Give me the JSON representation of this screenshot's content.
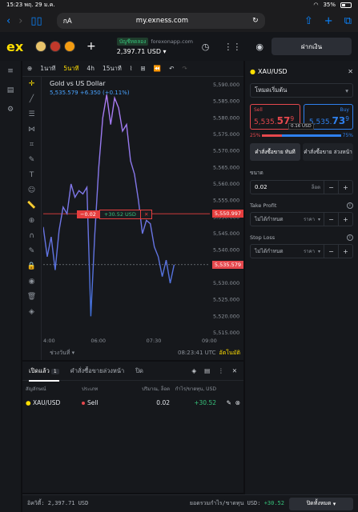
{
  "status": {
    "time": "15:23",
    "date": "พฤ. 29 ม.ค.",
    "battery": "35%"
  },
  "browser": {
    "tab_hint": "กA",
    "host": "my.exness.com"
  },
  "app": {
    "logo": "ex",
    "account_type": "บัญชีทดลอง",
    "server": "forexonapp.com",
    "balance": "2,397.71 USD",
    "deposit_label": "ฝากเงิน"
  },
  "chart_toolbar": {
    "timeframes": [
      "1นาที",
      "5นาที",
      "4h",
      "15นาที"
    ],
    "active_timeframe": "5นาที"
  },
  "chart_data": {
    "type": "line",
    "title": "Gold vs US Dollar",
    "price_line": "5,535.579  +6.350 (+0.11%)",
    "yticks": [
      "5,590.000",
      "5,585.000",
      "5,580.000",
      "5,575.000",
      "5,570.000",
      "5,565.000",
      "5,560.000",
      "5,555.000",
      "5,550.000",
      "5,545.000",
      "5,540.000",
      "5,535.000",
      "5,530.000",
      "5,525.000",
      "5,520.000",
      "5,515.000"
    ],
    "xticks": [
      "4:00",
      "06:00",
      "07:30",
      "09:00"
    ],
    "ylim": [
      5515,
      5590
    ],
    "x": [
      0,
      2,
      4,
      6,
      8,
      10,
      12,
      14,
      16,
      18,
      20,
      22,
      24,
      26,
      28,
      30,
      32,
      34,
      36,
      38,
      40,
      42,
      44,
      46,
      48,
      50,
      52,
      54,
      56,
      58,
      60,
      62,
      64,
      66
    ],
    "values": [
      5547,
      5538,
      5544,
      5534,
      5546,
      5553,
      5551,
      5560,
      5556,
      5558,
      5557,
      5559,
      5520,
      5545,
      5565,
      5580,
      5587,
      5578,
      5586,
      5583,
      5576,
      5578,
      5567,
      5563,
      5555,
      5545,
      5549,
      5548,
      5541,
      5538,
      5532,
      5537,
      5530,
      5535.6
    ],
    "current_price_label": "5,535.579",
    "order_price_label": "5,550.997",
    "order_line": {
      "volume_label": "−0.02",
      "pnl_label": "+30.52 USD"
    },
    "range_label": "ช่วงวันที่",
    "clock": "08:23:41 UTC",
    "auto_label": "อัตโนมัติ"
  },
  "panel": {
    "symbol": "XAU/USD",
    "mode": "โหมดเริ่มต้น",
    "sell": {
      "label": "Sell",
      "price_main": "5,535.",
      "price_big": "57",
      "price_sup": "9"
    },
    "buy": {
      "label": "Buy",
      "price_main": "5,535.",
      "price_big": "73",
      "price_sup": "9"
    },
    "spread": "0.16 USD",
    "sentiment_sell": "25%",
    "sentiment_buy": "75%",
    "sentiment_sell_fraction": 0.25,
    "order_market": "คำสั่งซื้อขาย ทันที",
    "order_pending": "คำสั่งซื้อขาย ล่วงหน้า",
    "volume_label": "ขนาด",
    "volume_value": "0.02",
    "volume_unit": "ล็อต",
    "tp_label": "Take Profit",
    "tp_value": "ไม่ได้กำหนด",
    "tp_unit": "ราคา",
    "sl_label": "Stop Loss",
    "sl_value": "ไม่ได้กำหนด",
    "sl_unit": "ราคา"
  },
  "positions": {
    "tab_open": "เปิดแล้ว",
    "open_count": "1",
    "tab_pending": "คำสั่งซื้อขายล่วงหน้า",
    "tab_closed": "ปิด",
    "headers": [
      "สัญลักษณ์",
      "ประเภท",
      "ปริมาณ, ล็อต",
      "กำไร/ขาดทุน, USD"
    ],
    "rows": [
      {
        "symbol": "XAU/USD",
        "type": "Sell",
        "volume": "0.02",
        "pnl": "+30.52"
      }
    ]
  },
  "footer": {
    "equity": "อิควิตี้: 2,397.71 USD",
    "total_label": "ยอดรวมกำไร/ขาดทุน USD:",
    "total_value": "+30.52",
    "close_all": "ปิดทั้งหมด"
  },
  "colors": {
    "accent": "#ffde02",
    "sell": "#e5484d",
    "buy": "#2f80ed",
    "profit": "#36c17a",
    "line": "#8b6cf0"
  }
}
